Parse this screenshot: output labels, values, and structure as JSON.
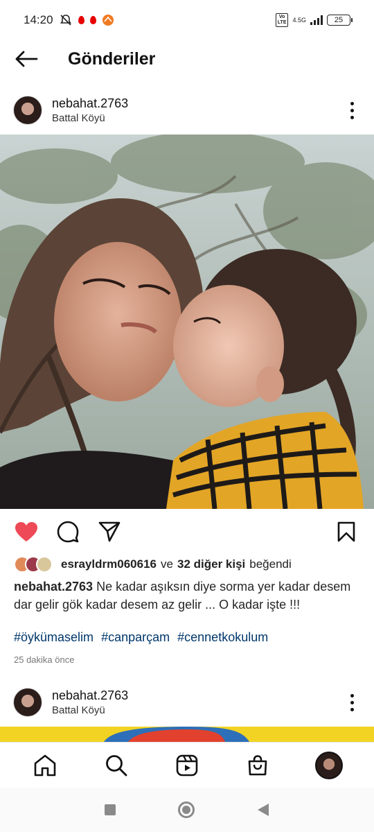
{
  "status_bar": {
    "time": "14:20",
    "network": "4.5G",
    "volte": "Vo\nLTE",
    "battery": "25"
  },
  "header": {
    "title": "Gönderiler"
  },
  "post": {
    "username": "nebahat.2763",
    "location": "Battal Köyü",
    "liked": true,
    "likes": {
      "liker": "esrayldrm060616",
      "connector": "ve",
      "others": "32 diğer kişi",
      "suffix": "beğendi"
    },
    "caption_user": "nebahat.2763",
    "caption_text": "Ne kadar aşıksın diye sorma yer kadar desem dar gelir gök kadar desem az gelir ... O kadar işte !!!",
    "hashtags": [
      "#öykümaselim",
      "#canparçam",
      "#cennetkokulum"
    ],
    "time_ago": "25 dakika önce"
  },
  "next_post": {
    "username": "nebahat.2763",
    "location": "Battal Köyü"
  },
  "colors": {
    "like_red": "#ed4956",
    "hashtag_blue": "#00376b"
  }
}
